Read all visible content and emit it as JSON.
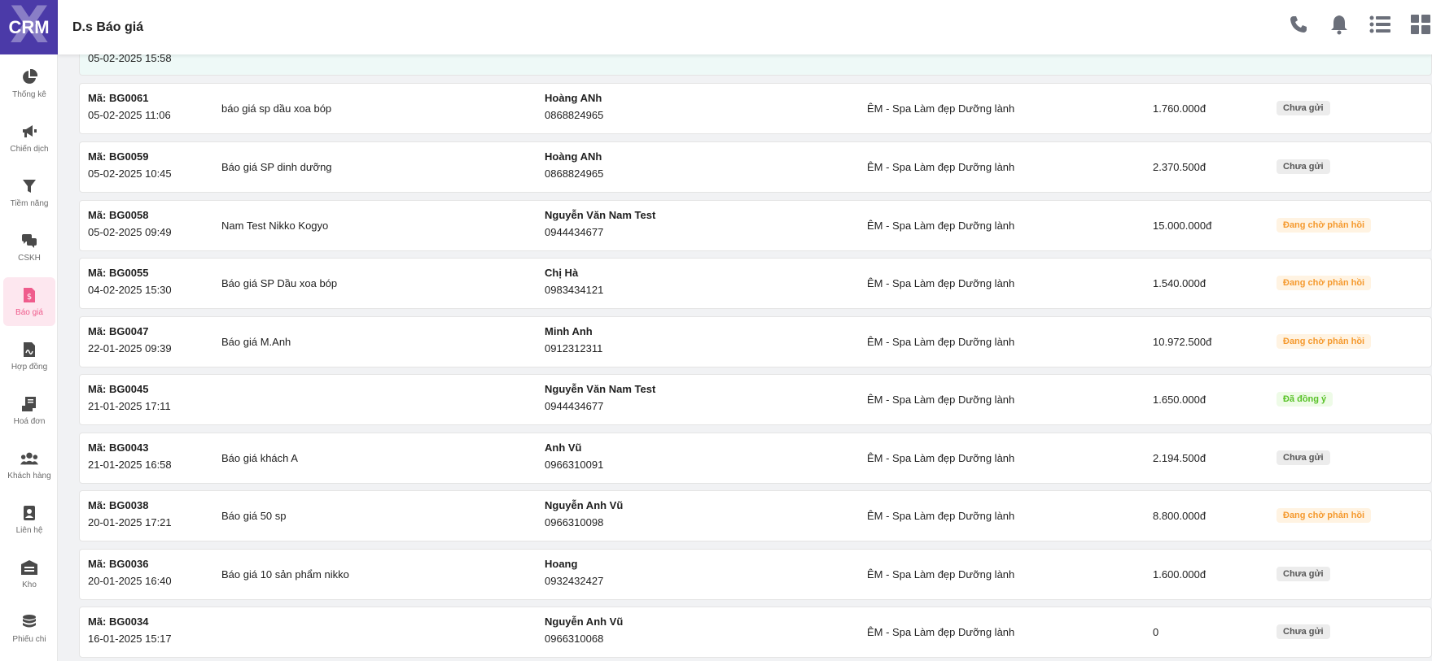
{
  "app": {
    "logo_text": "CRM",
    "page_title": "D.s Báo giá"
  },
  "sidebar": {
    "items": [
      {
        "label": "Thống kê",
        "icon": "pie-chart-icon"
      },
      {
        "label": "Chiến dịch",
        "icon": "megaphone-icon"
      },
      {
        "label": "Tiềm năng",
        "icon": "filter-icon"
      },
      {
        "label": "CSKH",
        "icon": "chat-icon"
      },
      {
        "label": "Báo giá",
        "icon": "quote-doc-icon",
        "active": true
      },
      {
        "label": "Hợp đồng",
        "icon": "contract-icon"
      },
      {
        "label": "Hoá đơn",
        "icon": "invoice-icon"
      },
      {
        "label": "Khách hàng",
        "icon": "users-icon"
      },
      {
        "label": "Liên hệ",
        "icon": "address-book-icon"
      },
      {
        "label": "Kho",
        "icon": "warehouse-icon"
      },
      {
        "label": "Phiếu chi",
        "icon": "coins-icon"
      }
    ]
  },
  "header_icons": [
    "phone-icon",
    "bell-icon",
    "list-icon",
    "grid-icon"
  ],
  "quotes": [
    {
      "code": "",
      "date": "05-02-2025 15:58",
      "name": "",
      "customer": "",
      "phone": "",
      "branch": "",
      "amount": "",
      "status": "",
      "status_type": "gray"
    },
    {
      "code": "Mã: BG0061",
      "date": "05-02-2025 11:06",
      "name": "báo giá sp dầu xoa bóp",
      "customer": "Hoàng ANh",
      "phone": "0868824965",
      "branch": "ÊM - Spa Làm đẹp Dưỡng lành",
      "amount": "1.760.000đ",
      "status": "Chưa gửi",
      "status_type": "gray"
    },
    {
      "code": "Mã: BG0059",
      "date": "05-02-2025 10:45",
      "name": "Báo giá SP dinh dưỡng",
      "customer": "Hoàng ANh",
      "phone": "0868824965",
      "branch": "ÊM - Spa Làm đẹp Dưỡng lành",
      "amount": "2.370.500đ",
      "status": "Chưa gửi",
      "status_type": "gray"
    },
    {
      "code": "Mã: BG0058",
      "date": "05-02-2025 09:49",
      "name": "Nam Test Nikko Kogyo",
      "customer": "Nguyễn Văn Nam Test",
      "phone": "0944434677",
      "branch": "ÊM - Spa Làm đẹp Dưỡng lành",
      "amount": "15.000.000đ",
      "status": "Đang chờ phản hồi",
      "status_type": "orange"
    },
    {
      "code": "Mã: BG0055",
      "date": "04-02-2025 15:30",
      "name": "Báo giá SP Dầu xoa bóp",
      "customer": "Chị Hà",
      "phone": "0983434121",
      "branch": "ÊM - Spa Làm đẹp Dưỡng lành",
      "amount": "1.540.000đ",
      "status": "Đang chờ phản hồi",
      "status_type": "orange"
    },
    {
      "code": "Mã: BG0047",
      "date": "22-01-2025 09:39",
      "name": "Báo giá M.Anh",
      "customer": "Minh Anh",
      "phone": "0912312311",
      "branch": "ÊM - Spa Làm đẹp Dưỡng lành",
      "amount": "10.972.500đ",
      "status": "Đang chờ phản hồi",
      "status_type": "orange"
    },
    {
      "code": "Mã: BG0045",
      "date": "21-01-2025 17:11",
      "name": "",
      "customer": "Nguyễn Văn Nam Test",
      "phone": "0944434677",
      "branch": "ÊM - Spa Làm đẹp Dưỡng lành",
      "amount": "1.650.000đ",
      "status": "Đã đồng ý",
      "status_type": "green"
    },
    {
      "code": "Mã: BG0043",
      "date": "21-01-2025 16:58",
      "name": "Báo giá khách A",
      "customer": "Anh Vũ",
      "phone": "0966310091",
      "branch": "ÊM - Spa Làm đẹp Dưỡng lành",
      "amount": "2.194.500đ",
      "status": "Chưa gửi",
      "status_type": "gray"
    },
    {
      "code": "Mã: BG0038",
      "date": "20-01-2025 17:21",
      "name": "Báo giá 50 sp",
      "customer": "Nguyễn Anh Vũ",
      "phone": "0966310098",
      "branch": "ÊM - Spa Làm đẹp Dưỡng lành",
      "amount": "8.800.000đ",
      "status": "Đang chờ phản hồi",
      "status_type": "orange"
    },
    {
      "code": "Mã: BG0036",
      "date": "20-01-2025 16:40",
      "name": "Báo giá 10 sản phẩm nikko",
      "customer": "Hoang",
      "phone": "0932432427",
      "branch": "ÊM - Spa Làm đẹp Dưỡng lành",
      "amount": "1.600.000đ",
      "status": "Chưa gửi",
      "status_type": "gray"
    },
    {
      "code": "Mã: BG0034",
      "date": "16-01-2025 15:17",
      "name": "",
      "customer": "Nguyễn Anh Vũ",
      "phone": "0966310068",
      "branch": "ÊM - Spa Làm đẹp Dưỡng lành",
      "amount": "0",
      "status": "Chưa gửi",
      "status_type": "gray"
    }
  ]
}
